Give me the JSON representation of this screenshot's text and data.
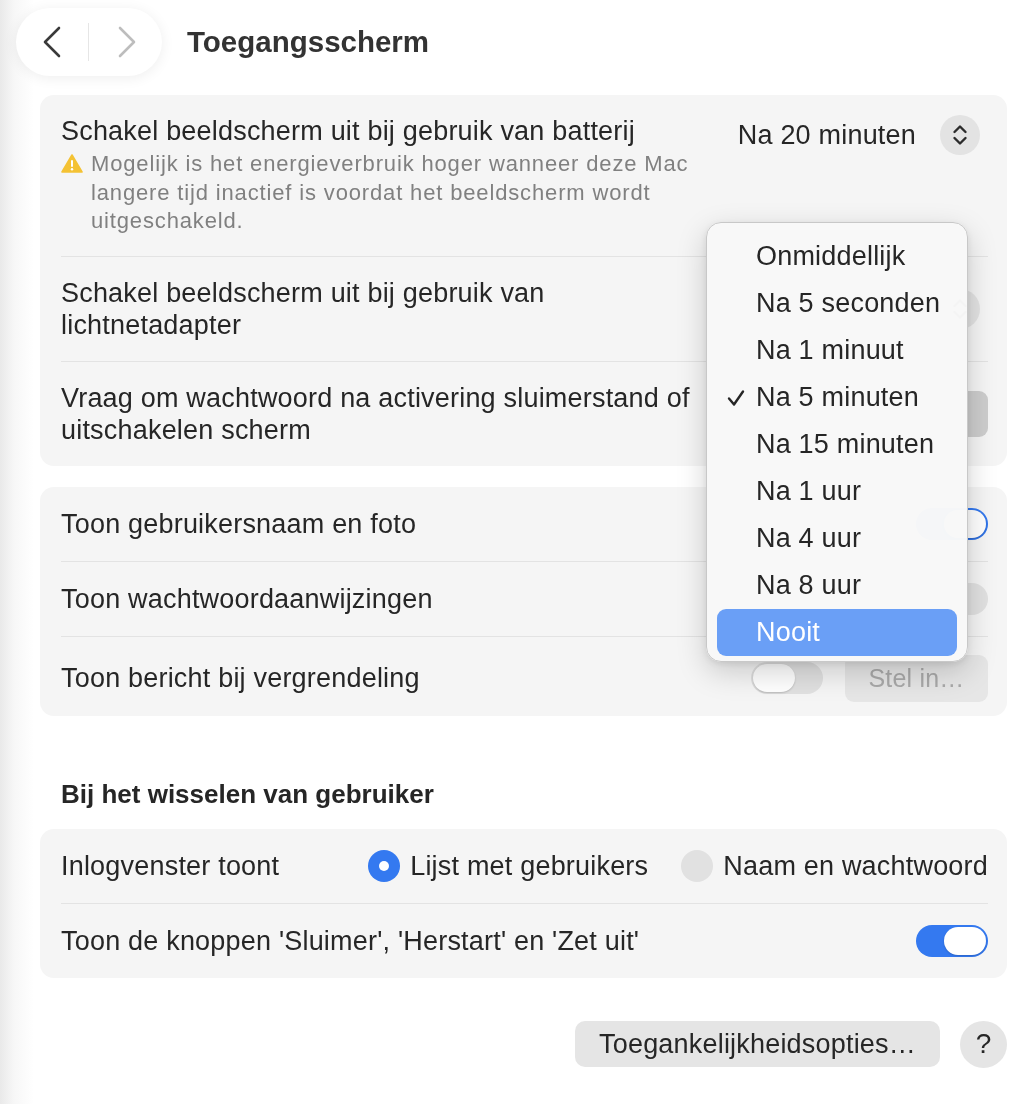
{
  "window": {
    "title": "Toegangsscherm"
  },
  "navigation": {
    "back": {
      "disabled": false
    },
    "forward": {
      "disabled": true
    }
  },
  "groups": [
    {
      "rows": [
        {
          "kind": "popup",
          "label": "Schakel beeldscherm uit bij gebruik van batterij",
          "warning": "Mogelijk is het energieverbruik hoger wanneer deze Mac langere tijd inactief is voordat het beeldscherm wordt uitgeschakeld.",
          "value": "Na 20 minuten",
          "pressed": false
        },
        {
          "kind": "popup",
          "label": "Schakel beeldscherm uit bij gebruik van lichtnetadapter",
          "pressed": false
        },
        {
          "kind": "popup",
          "label": "Vraag om wachtwoord na activering sluimerstand of uitschakelen scherm",
          "pressed": true
        }
      ]
    },
    {
      "rows": [
        {
          "kind": "toggle",
          "label": "Toon gebruikersnaam en foto",
          "on": true
        },
        {
          "kind": "toggle",
          "label": "Toon wachtwoordaanwijzingen",
          "on": false
        },
        {
          "kind": "toggle",
          "label": "Toon bericht bij vergrendeling",
          "on": false,
          "button": {
            "label": "Stel in…",
            "disabled": true
          }
        }
      ]
    },
    {
      "heading": "Bij het wisselen van gebruiker",
      "rows": [
        {
          "kind": "radio",
          "label": "Inlogvenster toont",
          "options": [
            {
              "label": "Lijst met gebruikers",
              "selected": true
            },
            {
              "label": "Naam en wachtwoord",
              "selected": false
            }
          ]
        },
        {
          "kind": "toggle",
          "label": "Toon de knoppen 'Sluimer', 'Herstart' en 'Zet uit'",
          "on": true
        }
      ]
    }
  ],
  "footer": {
    "buttons": [
      {
        "kind": "text",
        "label": "Toegankelijkheidsopties…"
      },
      {
        "kind": "help",
        "label": "?"
      }
    ]
  },
  "menu": {
    "items": [
      {
        "label": "Onmiddellijk",
        "checked": false,
        "selected": false
      },
      {
        "label": "Na 5 seconden",
        "checked": false,
        "selected": false
      },
      {
        "label": "Na 1 minuut",
        "checked": false,
        "selected": false
      },
      {
        "label": "Na 5 minuten",
        "checked": true,
        "selected": false
      },
      {
        "label": "Na 15 minuten",
        "checked": false,
        "selected": false
      },
      {
        "label": "Na 1 uur",
        "checked": false,
        "selected": false
      },
      {
        "label": "Na 4 uur",
        "checked": false,
        "selected": false
      },
      {
        "label": "Na 8 uur",
        "checked": false,
        "selected": false
      },
      {
        "label": "Nooit",
        "checked": false,
        "selected": true
      }
    ]
  }
}
